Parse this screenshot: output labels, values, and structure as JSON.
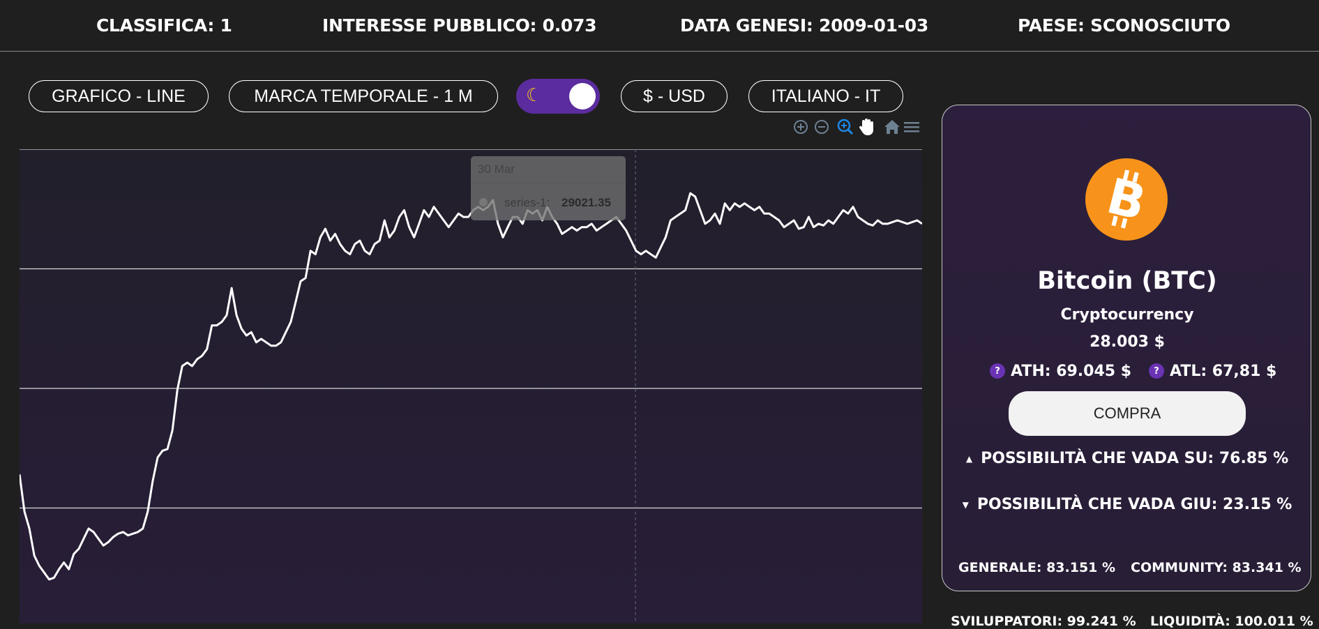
{
  "stats": {
    "rank": "CLASSIFICA: 1",
    "public_interest": "INTERESSE PUBBLICO: 0.073",
    "genesis_date": "DATA GENESI: 2009-01-03",
    "country": "PAESE: SCONOSCIUTO"
  },
  "controls": {
    "chart_type": "GRAFICO - LINE",
    "timeframe": "MARCA TEMPORALE - 1 M",
    "theme_toggle_icon": "moon-icon",
    "currency": "$ - USD",
    "language": "ITALIANO - IT"
  },
  "toolbar": {
    "icons": [
      "zoom-in-icon",
      "zoom-out-icon",
      "selection-zoom-icon",
      "pan-hand-icon",
      "home-reset-icon",
      "menu-icon"
    ],
    "active_color": "#1e88e5",
    "inactive_color": "#6e8192"
  },
  "chart_data": {
    "type": "line",
    "series": [
      {
        "name": "series-1",
        "color": "#ffffff",
        "values": [
          21400,
          20300,
          19800,
          19000,
          18700,
          18500,
          18300,
          18350,
          18600,
          18800,
          18600,
          19050,
          19200,
          19500,
          19800,
          19700,
          19500,
          19300,
          19400,
          19550,
          19650,
          19700,
          19600,
          19650,
          19700,
          19800,
          20300,
          21200,
          21900,
          22100,
          22150,
          22700,
          23900,
          24600,
          24700,
          24600,
          24800,
          24900,
          25100,
          25800,
          25800,
          25900,
          26100,
          26900,
          26100,
          25700,
          25500,
          25600,
          25300,
          25400,
          25300,
          25200,
          25200,
          25300,
          25600,
          25900,
          26500,
          27100,
          27200,
          28000,
          27900,
          28400,
          28650,
          28300,
          28500,
          28200,
          28000,
          27900,
          28200,
          28300,
          28000,
          27900,
          28200,
          28300,
          28900,
          28400,
          28600,
          29000,
          29200,
          28700,
          28400,
          28800,
          29200,
          29000,
          29300,
          29100,
          28900,
          28700,
          28900,
          29100,
          29000,
          29000,
          29200,
          29300,
          29200,
          29300,
          29500,
          28800,
          28400,
          28700,
          29000,
          29000,
          28800,
          29200,
          29100,
          29200,
          28900,
          29300,
          29000,
          28800,
          28500,
          28600,
          28700,
          28600,
          28700,
          28700,
          28800,
          28600,
          28700,
          28800,
          28900,
          29000,
          28800,
          28600,
          28300,
          28000,
          27900,
          28000,
          27900,
          27800,
          28100,
          28400,
          28900,
          29000,
          29100,
          29200,
          29700,
          29600,
          29200,
          28800,
          28900,
          29100,
          28800,
          29400,
          29200,
          29400,
          29300,
          29400,
          29300,
          29200,
          29300,
          29100,
          29100,
          29000,
          28900,
          28700,
          28800,
          28900,
          28650,
          28700,
          29000,
          28700,
          28800,
          28750,
          28900,
          28800,
          29000,
          29200,
          29100,
          29300,
          29000,
          28900,
          28800,
          28750,
          28900,
          28800,
          28800,
          28850,
          28900,
          28850,
          28800,
          28850,
          28900,
          28800
        ]
      }
    ],
    "ylim": [
      17000,
      31000
    ],
    "grid": true,
    "tooltip": {
      "date": "30 Mar",
      "series_label": "series-1:",
      "value": "29021.35"
    }
  },
  "coin": {
    "name": "Bitcoin (BTC)",
    "category": "Cryptocurrency",
    "price": "28.003 $",
    "ath": "ATH: 69.045 $",
    "atl": "ATL: 67,81 $",
    "help_glyph": "?",
    "buy_label": "COMPRA",
    "up_probability": "POSSIBILITÀ CHE VADA SU: 76.85 %",
    "down_probability": "POSSIBILITÀ CHE VADA GIU: 23.15 %",
    "general_score": "GENERALE: 83.151 %",
    "community_score": "COMMUNITY: 83.341 %",
    "developer_score": "SVILUPPATORI: 99.241 %",
    "liquidity_score": "LIQUIDITÀ: 100.011 %",
    "logo_color": "#f7931a",
    "logo_icon": "bitcoin-logo-icon"
  }
}
